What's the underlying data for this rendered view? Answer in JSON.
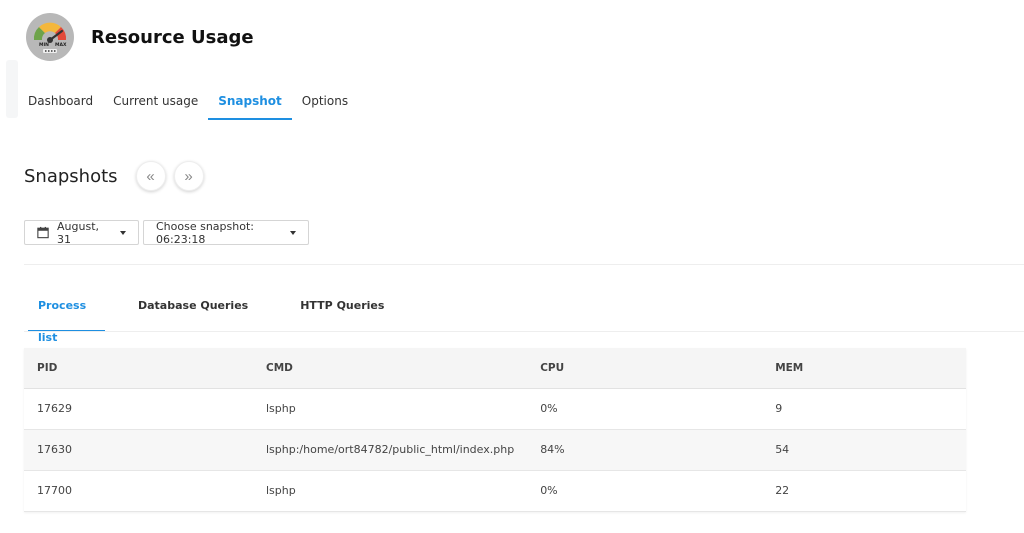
{
  "app": {
    "title": "Resource Usage",
    "logo": {
      "icon": "gauge-icon",
      "min_label": "MIN",
      "max_label": "MAX"
    }
  },
  "nav": {
    "items": [
      {
        "label": "Dashboard",
        "active": false
      },
      {
        "label": "Current usage",
        "active": false
      },
      {
        "label": "Snapshot",
        "active": true
      },
      {
        "label": "Options",
        "active": false
      }
    ]
  },
  "section": {
    "title": "Snapshots",
    "prev_icon": "«",
    "next_icon": "»"
  },
  "filters": {
    "date_label": "August, 31",
    "snapshot_label": "Choose snapshot: 06:23:18"
  },
  "subtabs": [
    {
      "label": "Process list",
      "active": true
    },
    {
      "label": "Database Queries",
      "active": false
    },
    {
      "label": "HTTP Queries",
      "active": false
    }
  ],
  "table": {
    "headers": [
      "PID",
      "CMD",
      "CPU",
      "MEM"
    ],
    "rows": [
      [
        "17629",
        "lsphp",
        "0%",
        "9"
      ],
      [
        "17630",
        "lsphp:/home/ort84782/public_html/index.php",
        "84%",
        "54"
      ],
      [
        "17700",
        "lsphp",
        "0%",
        "22"
      ]
    ]
  },
  "colors": {
    "accent": "#1e8fe1",
    "header_bg": "#f5f5f5",
    "stripe_bg": "#f7f7f7"
  }
}
